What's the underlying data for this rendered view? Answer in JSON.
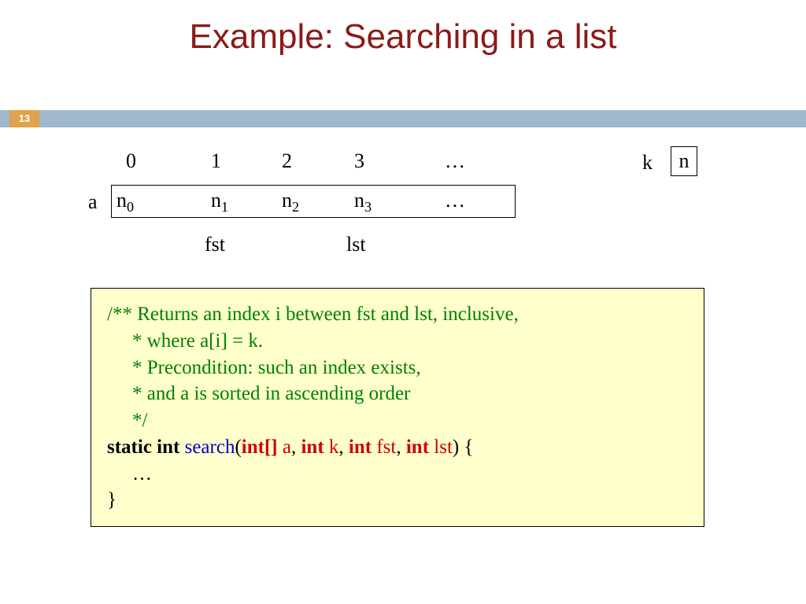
{
  "title": "Example: Searching in a list",
  "page": "13",
  "indices": {
    "i0": "0",
    "i1": "1",
    "i2": "2",
    "i3": "3",
    "dots": "…"
  },
  "array": {
    "label": "a",
    "c0b": "n",
    "c0s": "0",
    "c1b": "n",
    "c1s": "1",
    "c2b": "n",
    "c2s": "2",
    "c3b": "n",
    "c3s": "3",
    "dots": "…"
  },
  "pointers": {
    "fst": "fst",
    "lst": "lst"
  },
  "k": {
    "label": "k",
    "value": "n"
  },
  "code": {
    "c1": "/** Returns an index i between fst and lst, inclusive,",
    "c2": "* where a[i] = k.",
    "c3": "*  Precondition: such an index exists,",
    "c4": "*     and a is sorted in ascending order",
    "c5": "*/",
    "kw": "static int",
    "fn": "search",
    "p_open": "(",
    "t1": "int[]",
    "a1": " a",
    "sep": ", ",
    "t2": "int",
    "a2": " k",
    "t3": "int",
    "a3": " fst",
    "t4": "int",
    "a4": " lst",
    "p_close": ")",
    "brace_open": " {",
    "body": "…",
    "brace_close": "}"
  }
}
